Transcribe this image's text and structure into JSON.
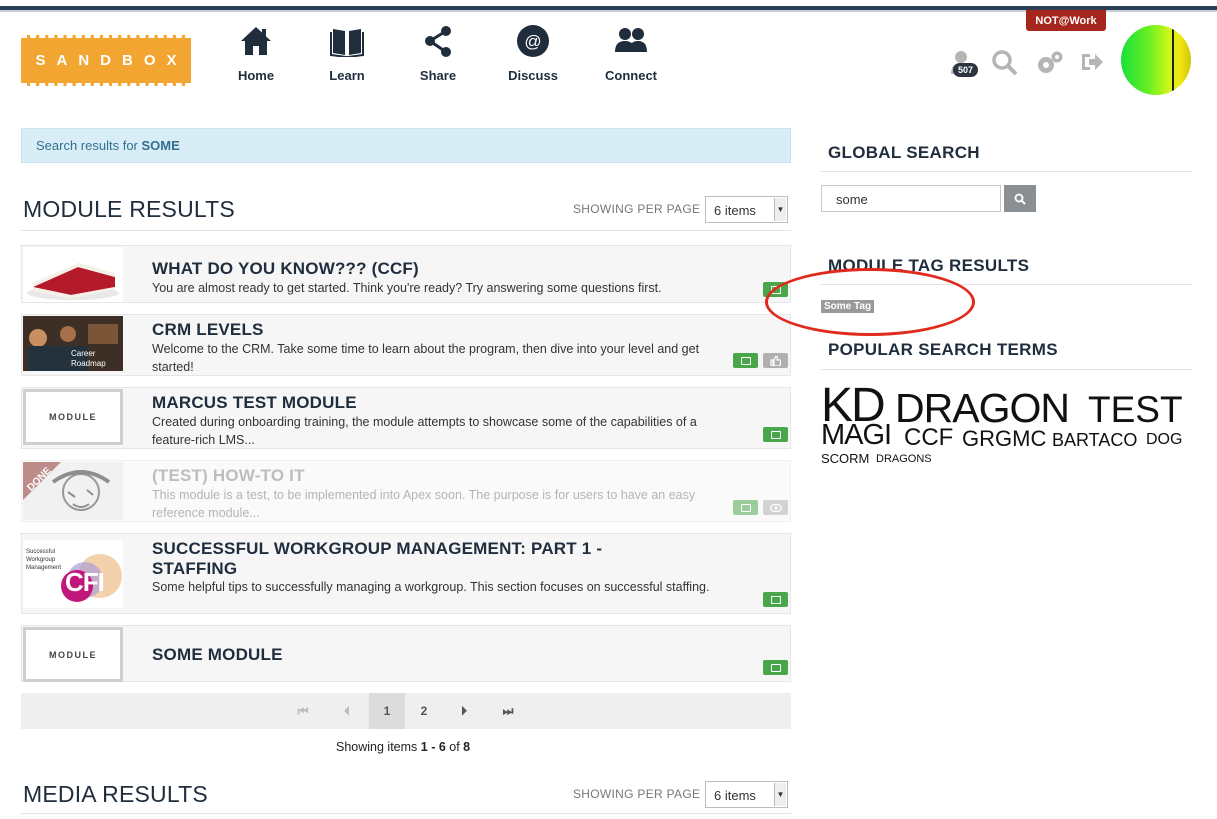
{
  "header": {
    "logo_text": "SANDBOX",
    "nav": [
      {
        "label": "Home",
        "icon": "home-icon"
      },
      {
        "label": "Learn",
        "icon": "book-icon"
      },
      {
        "label": "Share",
        "icon": "share-icon"
      },
      {
        "label": "Discuss",
        "icon": "at-icon"
      },
      {
        "label": "Connect",
        "icon": "users-icon"
      }
    ],
    "not_work_label": "NOT@Work",
    "user_badge_count": "507",
    "icons": [
      "user-icon",
      "search-icon",
      "gears-icon",
      "logout-icon"
    ]
  },
  "search_banner": {
    "prefix": "Search results for ",
    "term": "SOME"
  },
  "module_results": {
    "title": "MODULE RESULTS",
    "per_page_label": "SHOWING PER PAGE",
    "per_page_value": "6 items",
    "items": [
      {
        "title": "WHAT DO YOU KNOW??? (CCF)",
        "description": "You are almost ready to get started. Think you're ready? Try answering some questions first.",
        "thumb": "cake-image"
      },
      {
        "title": "CRM LEVELS",
        "description": "Welcome to the CRM. Take some time to learn about the program, then dive into your level and get started!",
        "thumb": "career-roadmap-image",
        "thumb_caption": "Career Roadmap"
      },
      {
        "title": "MARCUS TEST MODULE",
        "description": "Created during onboarding training, the module attempts to showcase some of the capabilities of a feature-rich LMS...",
        "thumb": "module-placeholder",
        "thumb_label": "MODULE"
      },
      {
        "title": "(TEST) HOW-TO IT",
        "description": "This module is a test, to be implemented into Apex soon. The purpose is for users to have an easy reference module...",
        "thumb": "sketch-image",
        "ribbon": "DONE"
      },
      {
        "title": "SUCCESSFUL WORKGROUP MANAGEMENT: PART 1 - STAFFING",
        "description": "Some helpful tips to successfully managing a workgroup. This section focuses on successful staffing.",
        "thumb": "workgroup-image",
        "thumb_caption": "Successful Workgroup Management",
        "thumb_logo": "CFI"
      },
      {
        "title": "SOME MODULE",
        "description": "",
        "thumb": "module-placeholder",
        "thumb_label": "MODULE"
      }
    ],
    "pager": {
      "pages": [
        "1",
        "2"
      ],
      "current": "1"
    },
    "showing": {
      "prefix": "Showing items ",
      "range": "1 - 6",
      "of": " of ",
      "total": "8"
    }
  },
  "media_results": {
    "title": "MEDIA RESULTS",
    "per_page_label": "SHOWING PER PAGE",
    "per_page_value": "6 items"
  },
  "sidebar": {
    "global_search_title": "GLOBAL SEARCH",
    "search_value": "some",
    "module_tag_title": "MODULE TAG RESULTS",
    "tag": "Some Tag",
    "popular_title": "POPULAR SEARCH TERMS",
    "terms": [
      "KD",
      "DRAGON",
      "TEST",
      "MAGI",
      "CCF",
      "GRGMC",
      "BARTACO",
      "DOG",
      "SCORM",
      "DRAGONS"
    ]
  },
  "colors": {
    "accent": "#f2a531",
    "nav_dark": "#1f2d3d",
    "green": "#4aa64a",
    "annotation": "#e02a1d",
    "not_work": "#a6261d"
  }
}
